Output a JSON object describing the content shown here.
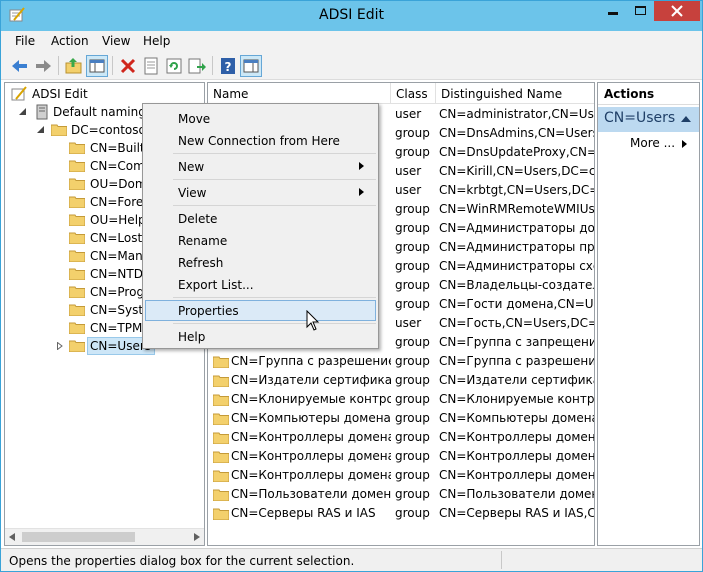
{
  "window": {
    "title": "ADSI Edit"
  },
  "menubar": {
    "items": [
      "File",
      "Action",
      "View",
      "Help"
    ]
  },
  "toolbar": {
    "buttons": [
      "back-icon",
      "forward-icon",
      "up-folder-icon",
      "console-tree-icon",
      "delete-icon",
      "properties-page-icon",
      "refresh-icon",
      "export-list-icon",
      "help-icon",
      "show-action-pane-icon"
    ]
  },
  "tree": {
    "items": [
      {
        "label": "ADSI Edit",
        "indent": 0
      },
      {
        "label": "Default naming c",
        "indent": 1
      },
      {
        "label": "DC=contoso,",
        "indent": 2
      },
      {
        "label": "CN=Builti",
        "indent": 3
      },
      {
        "label": "CN=Com",
        "indent": 3
      },
      {
        "label": "OU=Dom",
        "indent": 3
      },
      {
        "label": "CN=Forei",
        "indent": 3
      },
      {
        "label": "OU=Helpl",
        "indent": 3
      },
      {
        "label": "CN=LostA",
        "indent": 3
      },
      {
        "label": "CN=Mana",
        "indent": 3
      },
      {
        "label": "CN=NTDS",
        "indent": 3
      },
      {
        "label": "CN=Progi",
        "indent": 3
      },
      {
        "label": "CN=Syste",
        "indent": 3
      },
      {
        "label": "CN=TPM",
        "indent": 3
      },
      {
        "label": "CN=Users",
        "indent": 3,
        "selected": true
      }
    ]
  },
  "list": {
    "columns": [
      "Name",
      "Class",
      "Distinguished Name"
    ],
    "rows": [
      {
        "name": "",
        "class": "user",
        "dn": "CN=administrator,CN=Users,"
      },
      {
        "name": "",
        "class": "group",
        "dn": "CN=DnsAdmins,CN=Users,D"
      },
      {
        "name": "",
        "class": "group",
        "dn": "CN=DnsUpdateProxy,CN=Us"
      },
      {
        "name": "",
        "class": "user",
        "dn": "CN=Kirill,CN=Users,DC=cont"
      },
      {
        "name": "",
        "class": "user",
        "dn": "CN=krbtgt,CN=Users,DC=co"
      },
      {
        "name": "",
        "class": "group",
        "dn": "CN=WinRMRemoteWMIUser"
      },
      {
        "name": "",
        "class": "group",
        "dn": "CN=Администраторы доме"
      },
      {
        "name": "",
        "class": "group",
        "dn": "CN=Администраторы предп"
      },
      {
        "name": "",
        "class": "group",
        "dn": "CN=Администраторы схемі"
      },
      {
        "name": "",
        "class": "group",
        "dn": "CN=Владельцы-создатели г"
      },
      {
        "name": "",
        "class": "group",
        "dn": "CN=Гости домена,CN=User"
      },
      {
        "name": "",
        "class": "user",
        "dn": "CN=Гость,CN=Users,DC=cor"
      },
      {
        "name": "",
        "class": "group",
        "dn": "CN=Группа с запрещением"
      },
      {
        "name": "CN=Группа с разрешение",
        "class": "group",
        "dn": "CN=Группа с разрешением"
      },
      {
        "name": "CN=Издатели сертификатов",
        "class": "group",
        "dn": "CN=Издатели сертификато"
      },
      {
        "name": "CN=Клонируемые контро...",
        "class": "group",
        "dn": "CN=Клонируемые контрол"
      },
      {
        "name": "CN=Компьютеры домена",
        "class": "group",
        "dn": "CN=Компьютеры домена,C"
      },
      {
        "name": "CN=Контроллеры домена",
        "class": "group",
        "dn": "CN=Контроллеры домена,C"
      },
      {
        "name": "CN=Контроллеры домена...",
        "class": "group",
        "dn": "CN=Контроллеры домена -"
      },
      {
        "name": "CN=Контроллеры домена...",
        "class": "group",
        "dn": "CN=Контроллеры домена, ,"
      },
      {
        "name": "CN=Пользователи домена",
        "class": "group",
        "dn": "CN=Пользователи домена,("
      },
      {
        "name": "CN=Серверы RAS и IAS",
        "class": "group",
        "dn": "CN=Серверы RAS и IAS,CN"
      }
    ]
  },
  "actions": {
    "header": "Actions",
    "group": "CN=Users",
    "more": "More ..."
  },
  "context_menu": {
    "items": [
      {
        "label": "Move"
      },
      {
        "label": "New Connection from Here"
      },
      {
        "label": "New",
        "submenu": true
      },
      {
        "label": "View",
        "submenu": true
      },
      {
        "label": "Delete"
      },
      {
        "label": "Rename"
      },
      {
        "label": "Refresh"
      },
      {
        "label": "Export List..."
      },
      {
        "label": "Properties",
        "highlighted": true
      },
      {
        "label": "Help"
      }
    ]
  },
  "status": {
    "text": "Opens the properties dialog box for the current selection."
  },
  "colors": {
    "titlebar": "#6cc4ea",
    "close": "#c7413d",
    "selection": "#cde6f7",
    "folder": "#f3d06c",
    "actions_group": "#bcd9f0"
  }
}
